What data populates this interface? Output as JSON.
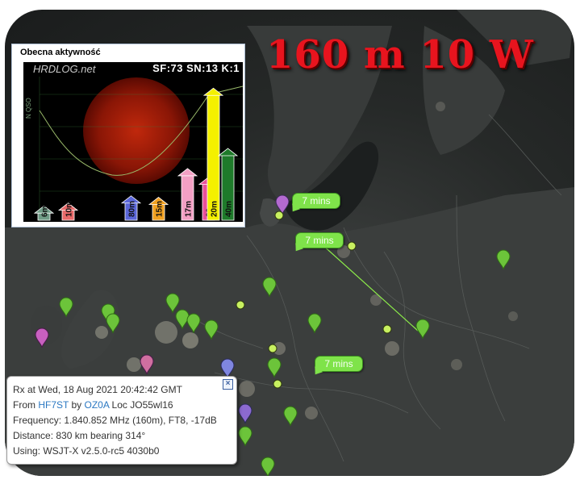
{
  "title": "160 m 10 W",
  "solar_widget": {
    "title": "Obecna aktywność",
    "brand": "HRDLOG.net",
    "stats": "SF:73 SN:13  K:1",
    "axis_label": "N QSO",
    "bands": [
      {
        "label": "6m",
        "level": 0.1,
        "color": "#6f9c86"
      },
      {
        "label": "10m",
        "level": 0.12,
        "color": "#e86a6a"
      },
      {
        "label": "80m",
        "level": 0.17,
        "color": "#5a66d8"
      },
      {
        "label": "15m",
        "level": 0.16,
        "color": "#f0a020"
      },
      {
        "label": "17m",
        "level": 0.36,
        "color": "#f3a0c4"
      },
      {
        "label": "30m",
        "level": 0.3,
        "color": "#e8509a"
      },
      {
        "label": "20m",
        "level": 0.92,
        "color": "#f4f000"
      },
      {
        "label": "40m",
        "level": 0.5,
        "color": "#1e7a2a"
      }
    ]
  },
  "map": {
    "callouts": [
      "7 mins",
      "7 mins",
      "7 mins"
    ]
  },
  "popup": {
    "line1": "Rx at Wed, 18 Aug 2021 20:42:42 GMT",
    "from_label": "From",
    "from_call": "HF7ST",
    "by_label": "by",
    "by_call": "OZ0A",
    "loc": "Loc JO55wl16",
    "frequency": "Frequency: 1.840.852 MHz (160m), FT8, -17dB",
    "distance": "Distance: 830 km bearing 314°",
    "using": "Using: WSJT-X v2.5.0-rc5 4030b0"
  },
  "colors": {
    "title": "#e8141e",
    "marker": "#6cc43a",
    "callout": "#7fe34a",
    "link": "#2b78c2"
  }
}
